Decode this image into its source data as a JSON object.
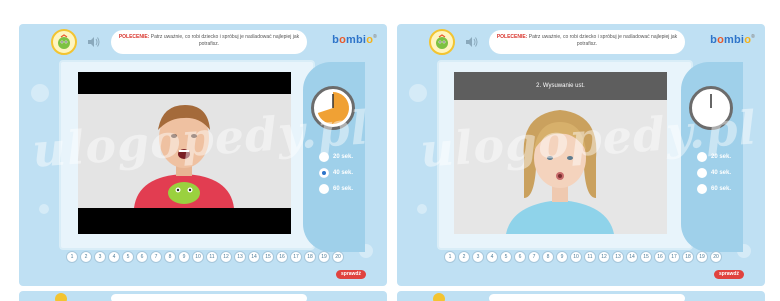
{
  "panels": [
    {
      "instruction_keyword": "POLECENIE:",
      "instruction_text": "Patrz uważnie, co robi dziecko i spróbuj je naśladować najlepiej jak potrafisz.",
      "logo": {
        "prefix": "b",
        "o1": "o",
        "mid": "mb",
        "i": "i",
        "o2": "o",
        "tm": "®"
      },
      "caption": "",
      "timer_fraction_remaining": 0.3,
      "options": [
        "20 sek.",
        "40 sek.",
        "60 sek."
      ],
      "selected_option": 1,
      "numbers": [
        "1",
        "2",
        "3",
        "4",
        "5",
        "6",
        "7",
        "8",
        "9",
        "10",
        "11",
        "12",
        "13",
        "14",
        "15",
        "16",
        "17",
        "18",
        "19",
        "20"
      ],
      "check_label": "sprawdź"
    },
    {
      "instruction_keyword": "POLECENIE:",
      "instruction_text": "Patrz uważnie, co robi dziecko i spróbuj je naśladować najlepiej jak potrafisz.",
      "logo": {
        "prefix": "b",
        "o1": "o",
        "mid": "mb",
        "i": "i",
        "o2": "o",
        "tm": "®"
      },
      "caption": "2. Wysuwanie ust.",
      "timer_fraction_remaining": 1.0,
      "options": [
        "20 sek.",
        "40 sek.",
        "60 sek."
      ],
      "selected_option": -1,
      "numbers": [
        "1",
        "2",
        "3",
        "4",
        "5",
        "6",
        "7",
        "8",
        "9",
        "10",
        "11",
        "12",
        "13",
        "14",
        "15",
        "16",
        "17",
        "18",
        "19",
        "20"
      ],
      "check_label": "sprawdź"
    }
  ],
  "watermark": "ulogopedy.pl",
  "colors": {
    "panel_bg": "#bfe0f3",
    "accent_red": "#e0433f",
    "timer_orange": "#f0a134",
    "brand_blue": "#2e74c9"
  }
}
